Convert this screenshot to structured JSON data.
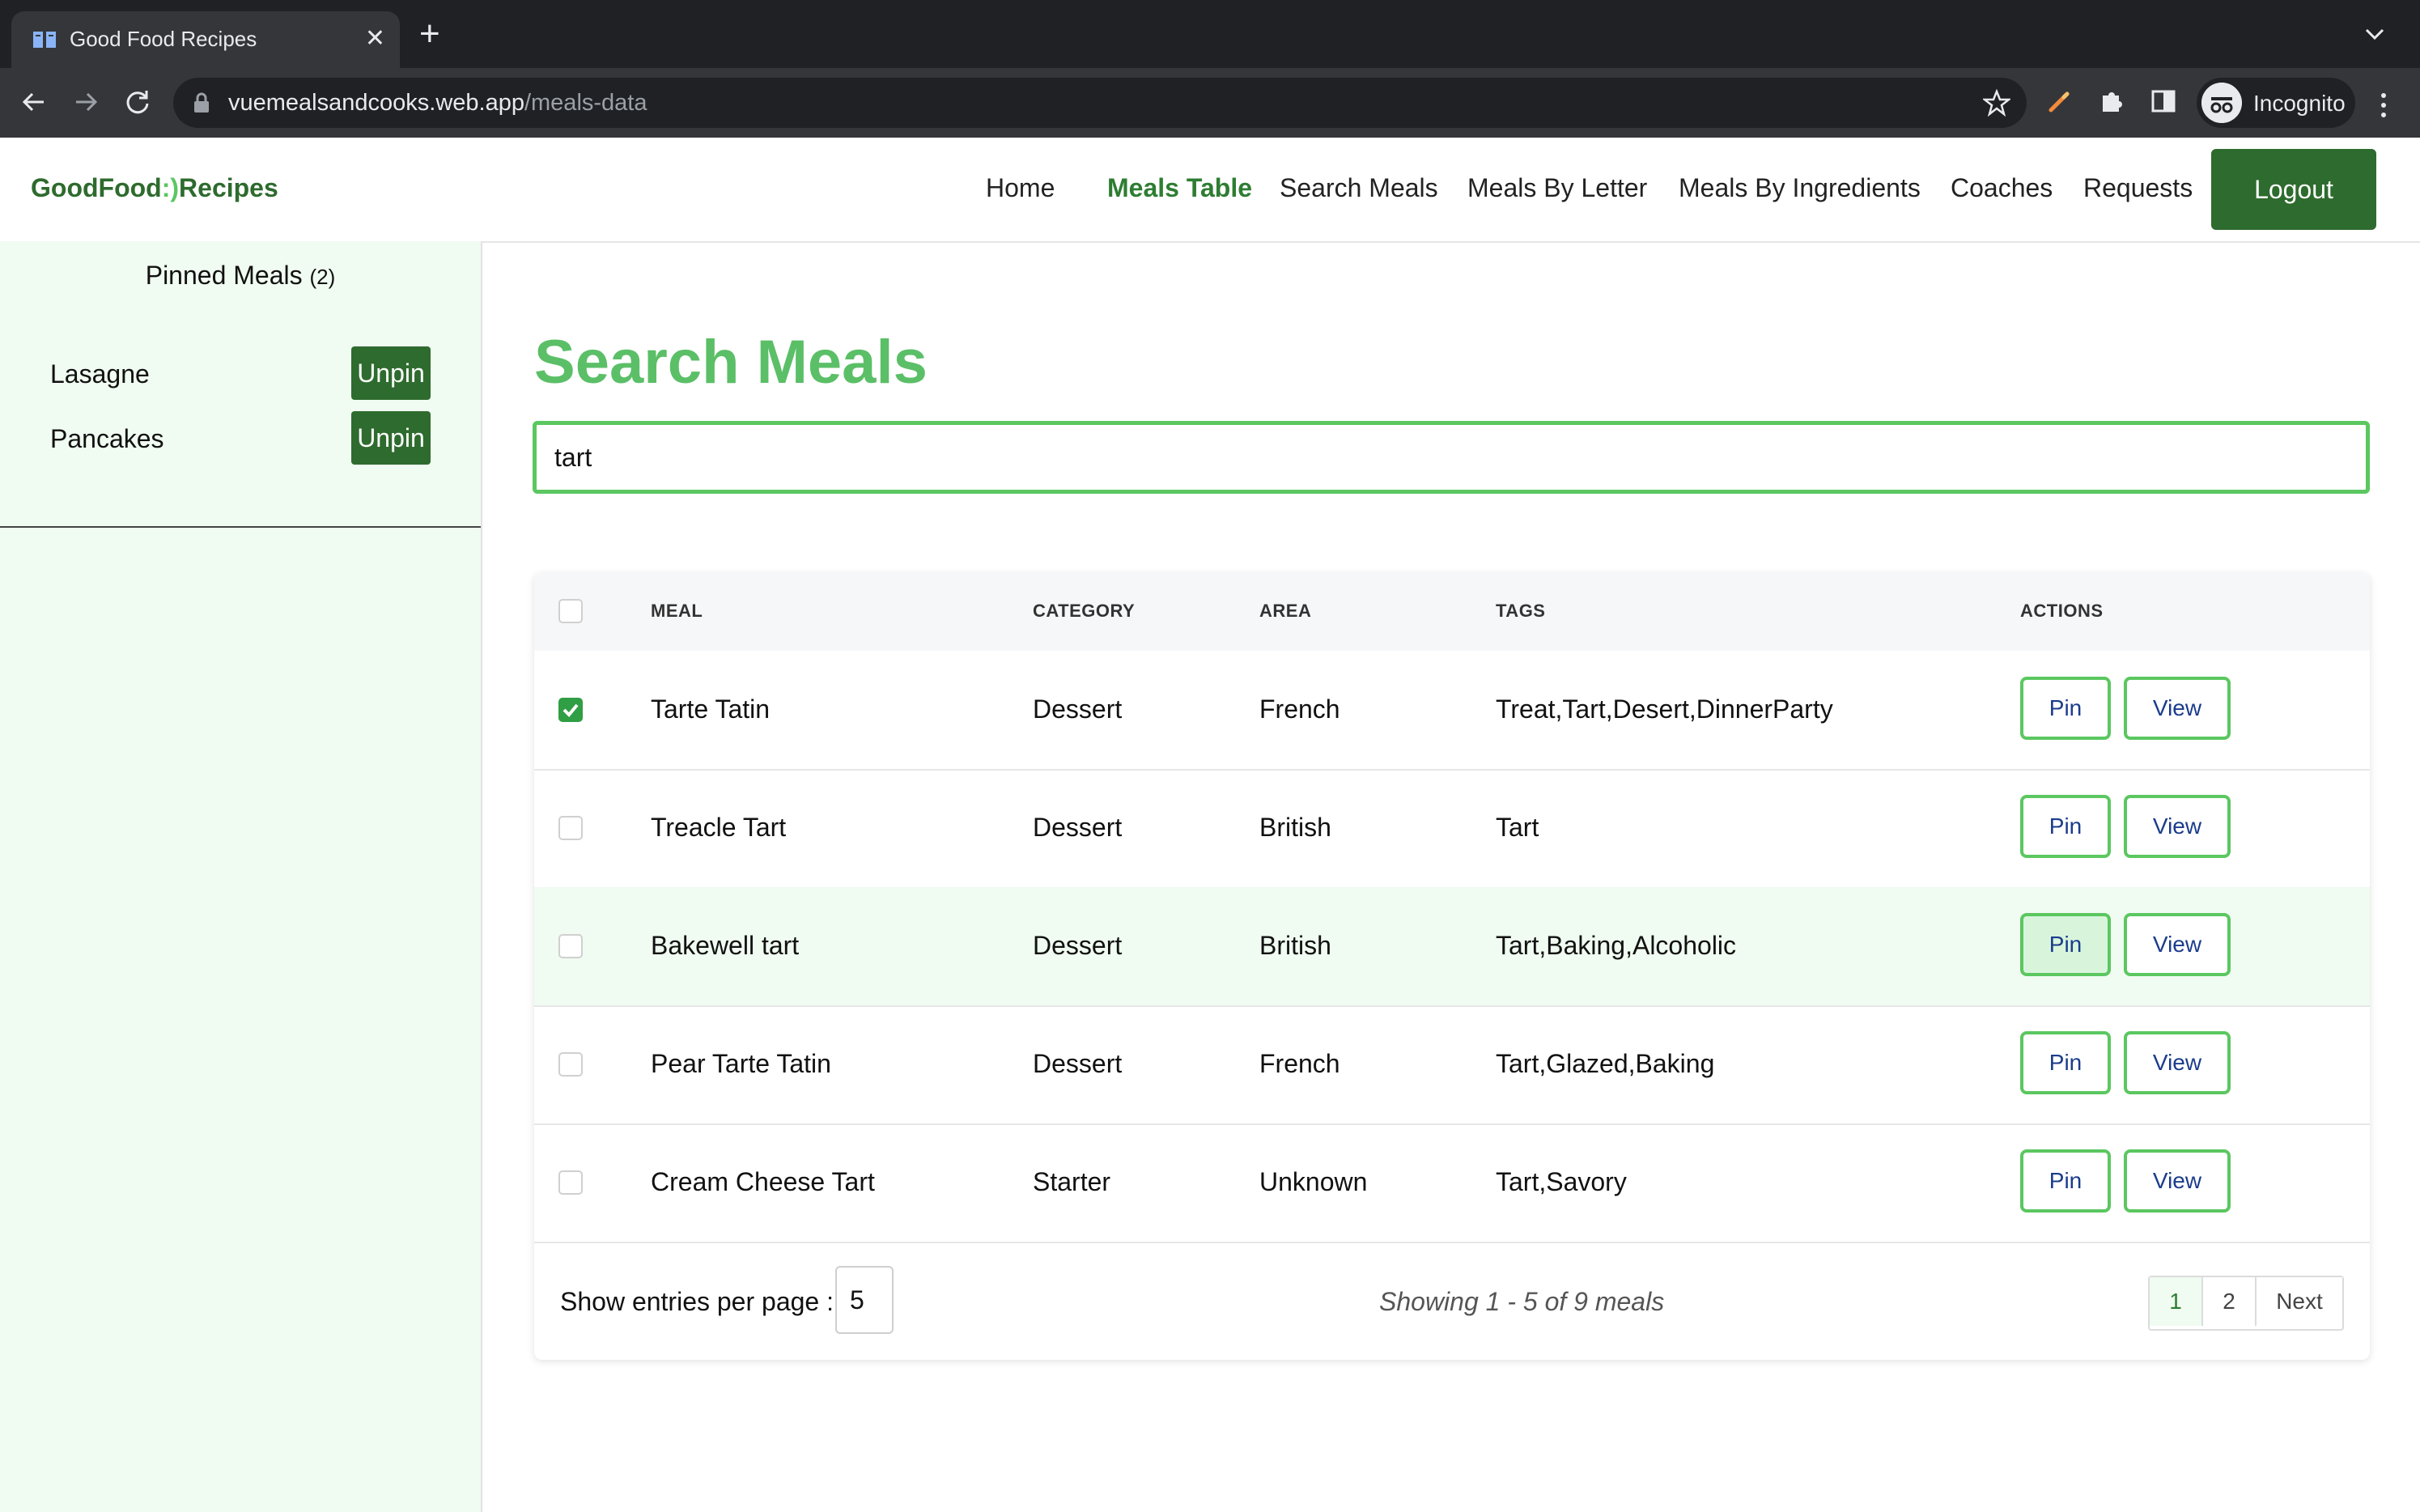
{
  "browser": {
    "tab_title": "Good Food Recipes",
    "tab_close": "✕",
    "new_tab": "+",
    "url_host": "vuemealsandcooks.web.app",
    "url_path": "/meals-data",
    "profile_label": "Incognito"
  },
  "header": {
    "brand_left": "GoodFood",
    "brand_smile": ":)",
    "brand_right": "Recipes",
    "nav": [
      "Home",
      "Meals Table",
      "Search Meals",
      "Meals By Letter",
      "Meals By Ingredients",
      "Coaches",
      "Requests"
    ],
    "active_nav": "Meals Table",
    "logout_label": "Logout"
  },
  "sidebar": {
    "title": "Pinned Meals",
    "count": "(2)",
    "items": [
      {
        "name": "Lasagne",
        "button": "Unpin"
      },
      {
        "name": "Pancakes",
        "button": "Unpin"
      }
    ]
  },
  "main": {
    "title": "Search Meals",
    "search_value": "tart",
    "columns": [
      "MEAL",
      "CATEGORY",
      "AREA",
      "TAGS",
      "ACTIONS"
    ],
    "rows": [
      {
        "meal": "Tarte Tatin",
        "category": "Dessert",
        "area": "French",
        "tags": "Treat,Tart,Desert,DinnerParty",
        "checked": true,
        "pin": "Pin",
        "view": "View"
      },
      {
        "meal": "Treacle Tart",
        "category": "Dessert",
        "area": "British",
        "tags": "Tart",
        "checked": false,
        "pin": "Pin",
        "view": "View"
      },
      {
        "meal": "Bakewell tart",
        "category": "Dessert",
        "area": "British",
        "tags": "Tart,Baking,Alcoholic",
        "checked": false,
        "pin": "Pin",
        "view": "View"
      },
      {
        "meal": "Pear Tarte Tatin",
        "category": "Dessert",
        "area": "French",
        "tags": "Tart,Glazed,Baking",
        "checked": false,
        "pin": "Pin",
        "view": "View"
      },
      {
        "meal": "Cream Cheese Tart",
        "category": "Starter",
        "area": "Unknown",
        "tags": "Tart,Savory",
        "checked": false,
        "pin": "Pin",
        "view": "View"
      }
    ],
    "entries_label": "Show entries per page :",
    "entries_value": "5",
    "showing_text": "Showing 1 - 5 of 9 meals",
    "pages": [
      "1",
      "2",
      "Next"
    ],
    "current_page": "1"
  },
  "colors": {
    "brand_green": "#2e6b2e",
    "accent_green": "#5bc760",
    "title_green": "#5bbf67",
    "sidebar_bg": "#f0fbf1"
  }
}
